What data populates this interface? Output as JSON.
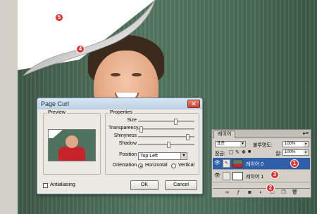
{
  "colors": {
    "accent_selection": "#2f5fa8",
    "callout": "#e23030",
    "shirt": "#c8232b"
  },
  "callouts": [
    "5",
    "4",
    "1",
    "3",
    "2",
    "6"
  ],
  "dialog": {
    "title": "Page Curl",
    "close_icon": "close-icon",
    "preview_label": "Preview",
    "properties_label": "Properties",
    "properties": {
      "size": {
        "label": "Size",
        "value": 0.68
      },
      "transparency": {
        "label": "Transparency",
        "value": 0.02
      },
      "shinyness": {
        "label": "Shinyness",
        "value": 0.9
      },
      "shadow": {
        "label": "Shadow",
        "value": 0.55
      },
      "position": {
        "label": "Position",
        "value": "Top Left"
      },
      "orientation": {
        "label": "Orientation",
        "options": [
          "Horizontal",
          "Vertical"
        ],
        "selected": "Horizontal"
      }
    },
    "antialiasing": {
      "label": "Antialiasing",
      "checked": false
    },
    "ok_label": "OK",
    "cancel_label": "Cancel"
  },
  "layers_panel": {
    "tab": "레이어",
    "menu_icon": "panel-menu-icon",
    "blend_mode": "표준",
    "opacity_label": "불투명도:",
    "opacity_value": "100%",
    "lock_label": "잠금:",
    "fill_label": "칠:",
    "fill_value": "100%",
    "layers": [
      {
        "name": "레이어 0",
        "selected": true,
        "icon": "eye-icon"
      },
      {
        "name": "레이어 1",
        "selected": false,
        "icon": "eye-icon"
      }
    ],
    "bottom_icons": [
      "link-icon",
      "fx-icon",
      "mask-icon",
      "adjustment-icon",
      "folder-icon",
      "new-layer-icon",
      "trash-icon"
    ]
  }
}
